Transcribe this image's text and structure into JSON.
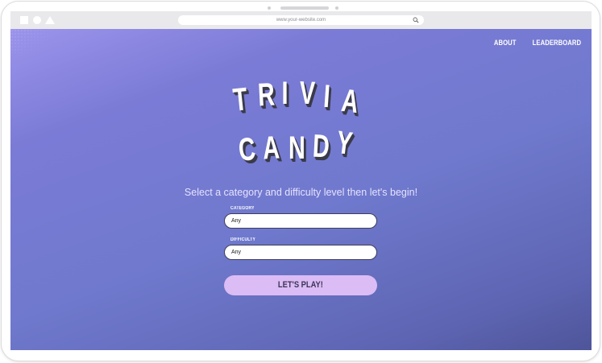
{
  "browser": {
    "url": "www.your-website.com",
    "icons": [
      "square-icon",
      "circle-icon",
      "triangle-icon",
      "search-icon"
    ]
  },
  "nav": {
    "about": "ABOUT",
    "leaderboard": "LEADERBOARD"
  },
  "logo": {
    "line1": [
      "T",
      "R",
      "I",
      "V",
      "I",
      "A"
    ],
    "line2": [
      "C",
      "A",
      "N",
      "D",
      "Y"
    ]
  },
  "subtitle": "Select a category and difficulty level then let's begin!",
  "form": {
    "category_label": "CATEGORY",
    "category_value": "Any",
    "difficulty_label": "DIFFICULTY",
    "difficulty_value": "Any"
  },
  "play_button": "LET'S PLAY!",
  "colors": {
    "background_top": "#9c94ec",
    "background_bottom": "#4f5599",
    "button": "#dcbcf4",
    "subtitle": "#e6e2ff"
  }
}
